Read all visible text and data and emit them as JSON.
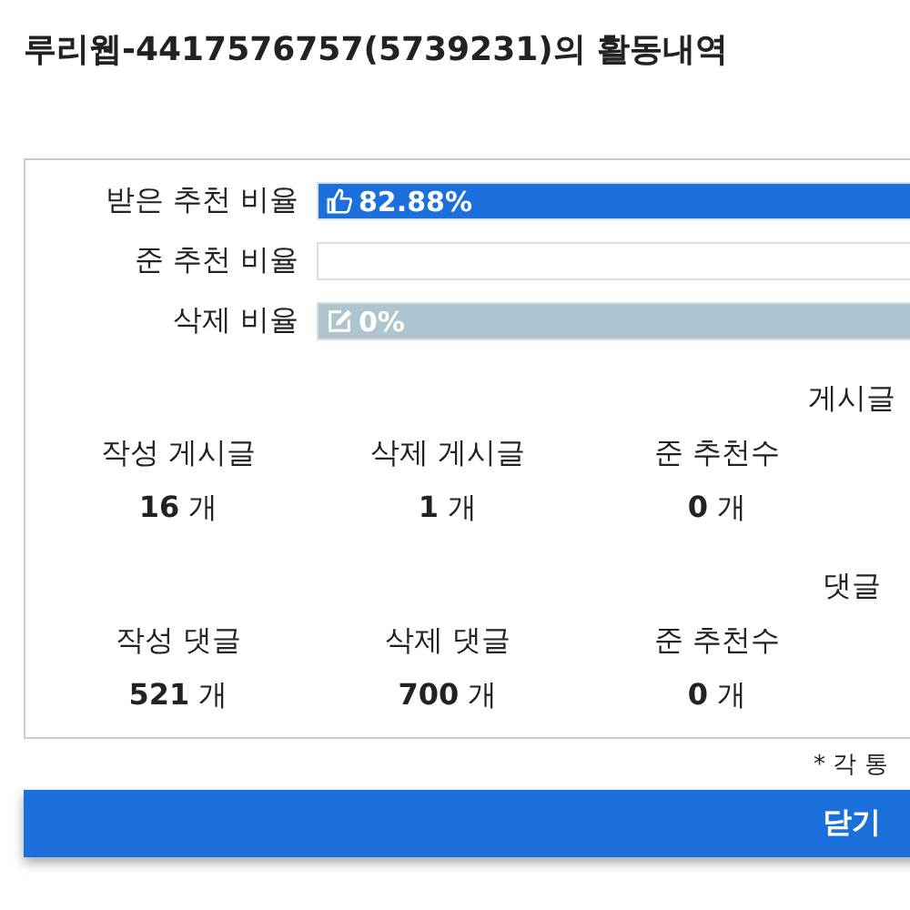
{
  "title": "루리웹-4417576757(5739231)의 활동내역",
  "rates": [
    {
      "label": "받은 추천 비율",
      "kind": "like",
      "level": 0.8288,
      "text": "82.88%"
    },
    {
      "label": "준 추천 비율",
      "kind": "plain"
    },
    {
      "label": "삭제 비율",
      "kind": "delete",
      "text": "0%"
    }
  ],
  "groups": [
    {
      "header": "게시글",
      "stats": [
        {
          "label": "작성 게시글",
          "value": "16",
          "unit": "개"
        },
        {
          "label": "삭제 게시글",
          "value": "1",
          "unit": "개"
        },
        {
          "label": "준 추천수",
          "value": "0",
          "unit": "개"
        }
      ]
    },
    {
      "header": "댓글",
      "stats": [
        {
          "label": "작성 댓글",
          "value": "521",
          "unit": "개"
        },
        {
          "label": "삭제 댓글",
          "value": "700",
          "unit": "개"
        },
        {
          "label": "준 추천수",
          "value": "0",
          "unit": "개"
        }
      ]
    }
  ],
  "note": "* 각 통",
  "close_button": "닫기"
}
